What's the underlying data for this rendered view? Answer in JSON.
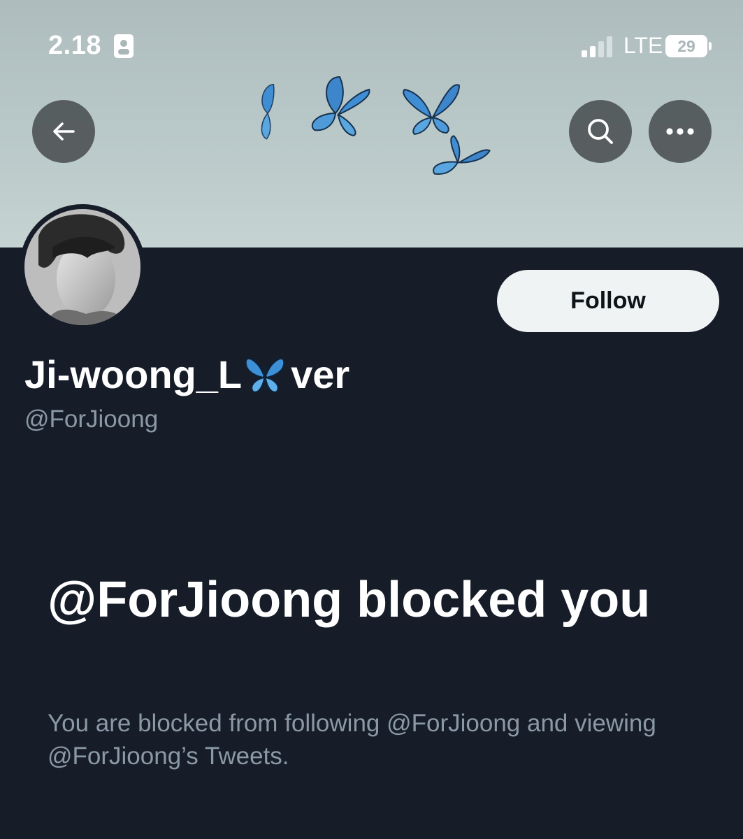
{
  "status_bar": {
    "time": "2.18",
    "network": "LTE",
    "battery_level": "29"
  },
  "colors": {
    "background": "#161d29",
    "banner": "#b7c6c6",
    "follow_button_bg": "#eff3f4",
    "secondary_text": "#8b98a5",
    "butterfly_blue": "#3d8fd6"
  },
  "header": {
    "back_icon": "arrow-left-icon",
    "search_icon": "search-icon",
    "more_icon": "more-horizontal-icon"
  },
  "profile": {
    "name_prefix": "Ji-woong_L",
    "name_suffix": "ver",
    "name_emoji": "butterfly",
    "handle": "@ForJioong",
    "follow_label": "Follow"
  },
  "blocked": {
    "title": "@ForJioong blocked you",
    "description": "You are blocked from following @ForJioong and viewing @ForJioong’s Tweets."
  }
}
